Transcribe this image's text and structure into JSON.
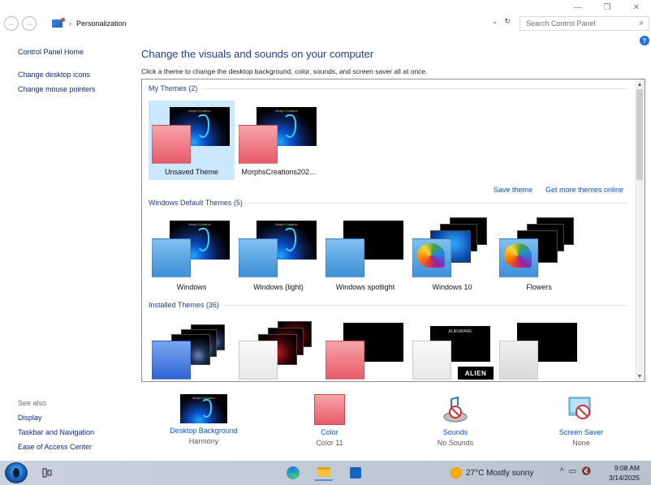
{
  "window": {
    "minimize": "—",
    "restore": "❐",
    "close": "✕"
  },
  "address": {
    "back": "←",
    "forward": "→",
    "breadcrumb_sep": "›",
    "breadcrumb": "Personalization",
    "dropdown": "⌄",
    "refresh": "↻",
    "search_placeholder": "Search Control Panel",
    "search_icon": "⌕"
  },
  "help_icon": "?",
  "left_nav": {
    "home": "Control Panel Home",
    "items": [
      "Change desktop icons",
      "Change mouse pointers"
    ]
  },
  "see_also": {
    "heading": "See also",
    "items": [
      "Display",
      "Taskbar and Navigation",
      "Ease of Access Center"
    ]
  },
  "main": {
    "title": "Change the visuals and sounds on your computer",
    "subtitle": "Click a theme to change the desktop background, color, sounds, and screen saver all at once."
  },
  "groups": {
    "my_themes": "My Themes (2)",
    "default_themes": "Windows Default Themes (5)",
    "installed_themes": "Installed Themes (36)"
  },
  "my_themes": [
    {
      "label": "Unsaved Theme",
      "selected": true
    },
    {
      "label": "MorphsCreations202...",
      "selected": false
    }
  ],
  "links": {
    "save": "Save theme",
    "more": "Get more themes online"
  },
  "default_themes": [
    {
      "label": "Windows"
    },
    {
      "label": "Windows (light)"
    },
    {
      "label": "Windows spotlight"
    },
    {
      "label": "Windows 10"
    },
    {
      "label": "Flowers"
    }
  ],
  "installed_alien_label": "ALIEN",
  "installed_alienware_label": "ALIENWARE",
  "bottom": {
    "background": {
      "name": "Desktop Background",
      "value": "Harmony"
    },
    "color": {
      "name": "Color",
      "value": "Color 11"
    },
    "sounds": {
      "name": "Sounds",
      "value": "No Sounds"
    },
    "screensaver": {
      "name": "Screen Saver",
      "value": "None"
    }
  },
  "taskbar": {
    "task_view_icon": "task-view-icon",
    "weather": "27°C  Mostly sunny",
    "tray": [
      "^",
      "▭",
      "🔇"
    ],
    "time": "9:08 AM",
    "date": "3/14/2025"
  },
  "colors": {
    "link": "#0a55c8",
    "title": "#1e3f8a",
    "selection": "#cce8ff",
    "accent_color": "#e75b69"
  }
}
